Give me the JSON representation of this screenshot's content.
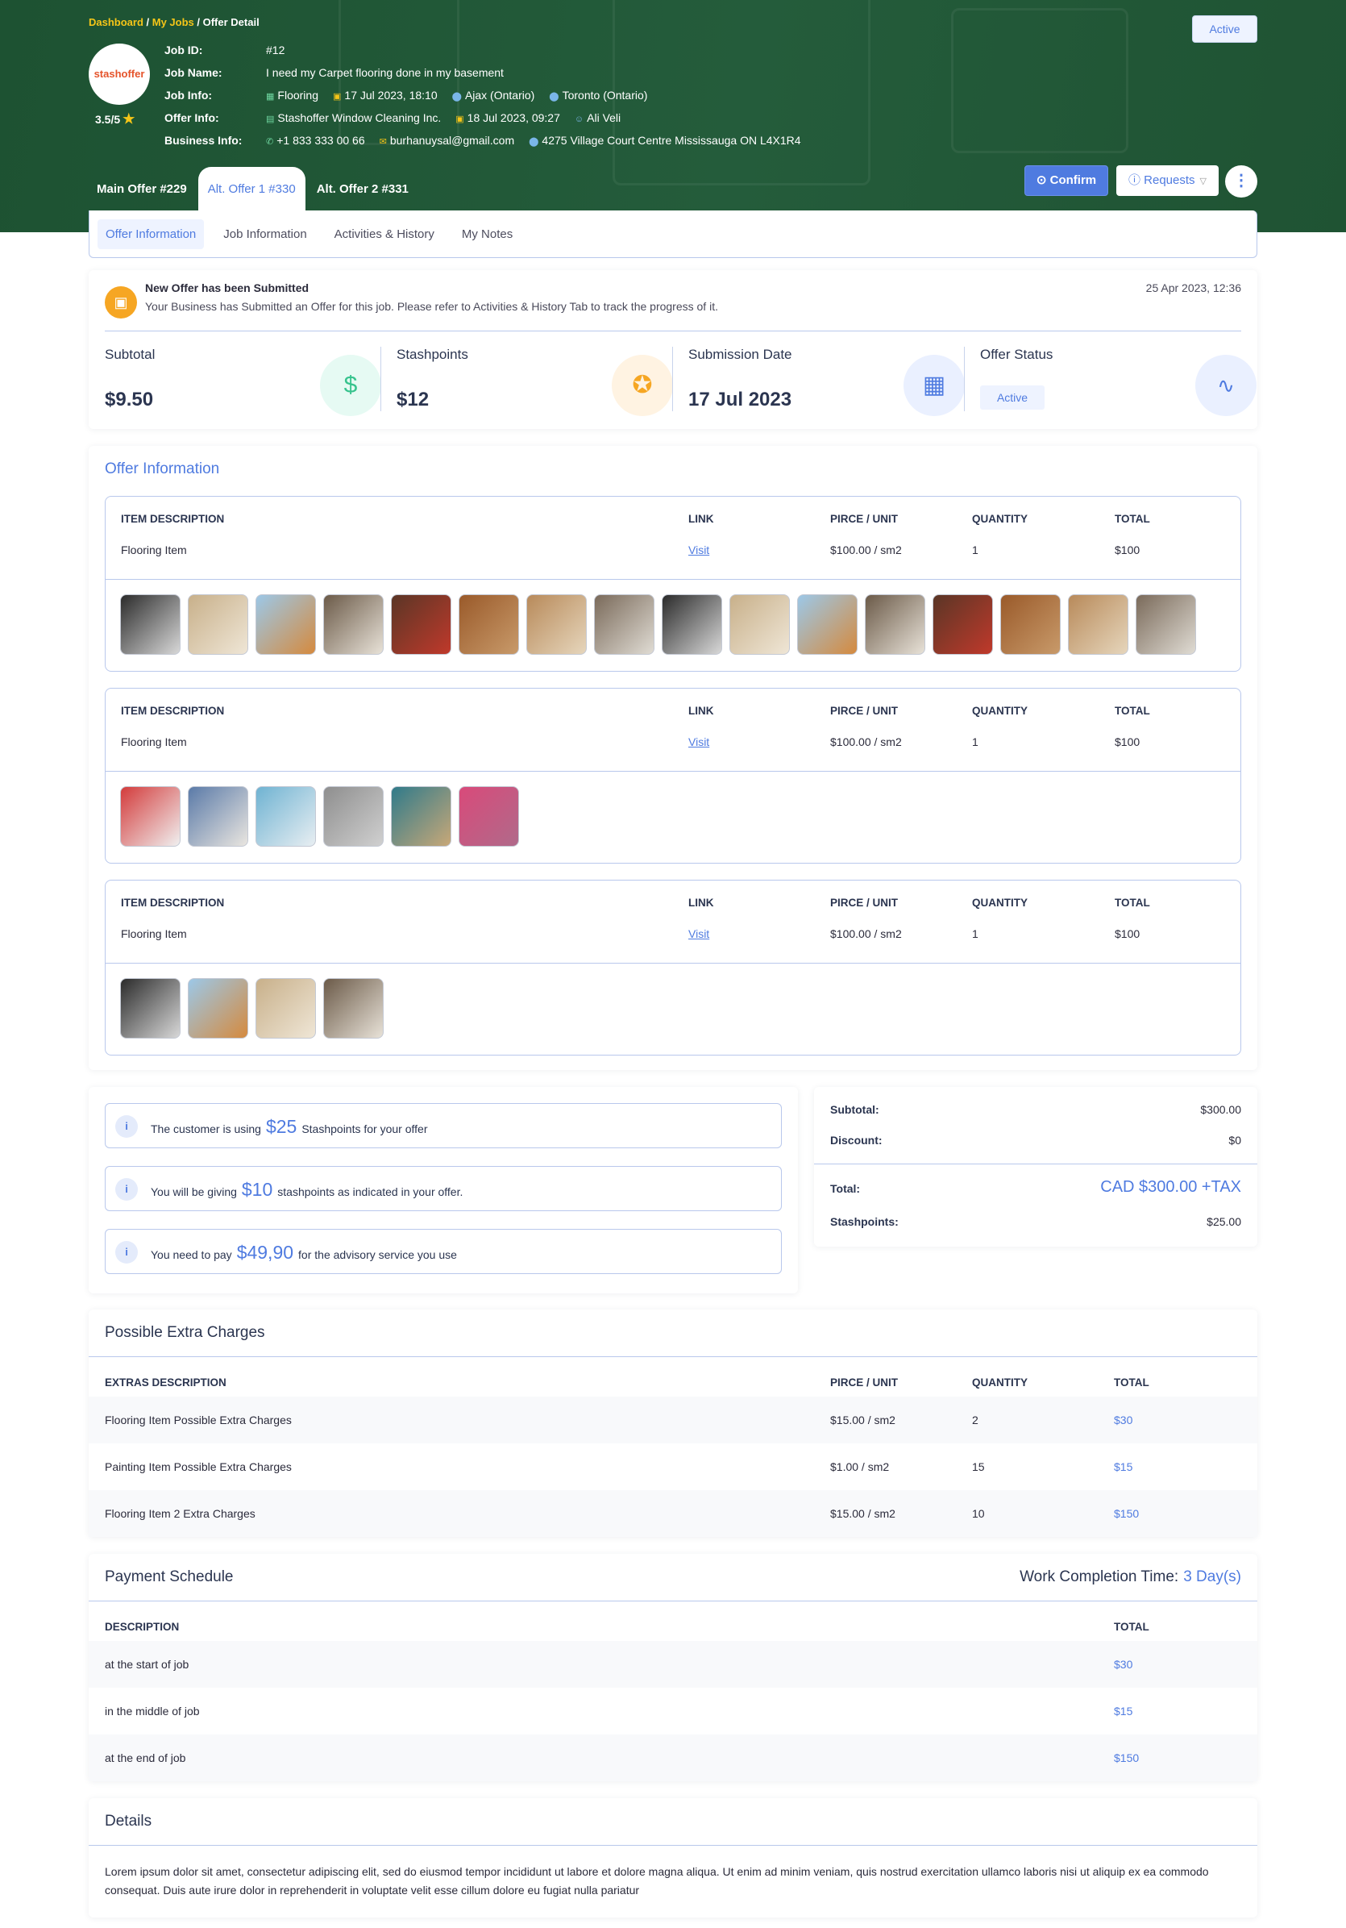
{
  "breadcrumb": {
    "dashboard": "Dashboard",
    "sep1": " / ",
    "myjobs": "My Jobs",
    "sep2": " / ",
    "current": "Offer Detail"
  },
  "header": {
    "status": "Active",
    "logo_text": "stashoffer",
    "rating": "3.5/5",
    "job_id": {
      "label": "Job ID:",
      "value": "#12"
    },
    "job_name": {
      "label": "Job Name:",
      "value": "I need my Carpet flooring done in my basement"
    },
    "job_info": {
      "label": "Job Info:",
      "category": "Flooring",
      "date": "17 Jul 2023, 18:10",
      "from": "Ajax (Ontario)",
      "to": "Toronto (Ontario)"
    },
    "offer_info": {
      "label": "Offer Info:",
      "company": "Stashoffer Window Cleaning Inc.",
      "date": "18 Jul 2023, 09:27",
      "person": "Ali Veli"
    },
    "business_info": {
      "label": "Business Info:",
      "phone": "+1 833 333 00 66",
      "email": "burhanuysal@gmail.com",
      "address": "4275 Village Court Centre Mississauga ON L4X1R4"
    }
  },
  "offer_tabs": [
    "Main Offer #229",
    "Alt. Offer 1 #330",
    "Alt. Offer 2 #331"
  ],
  "actions": {
    "confirm": "Confirm",
    "requests": "Requests"
  },
  "subnav": [
    "Offer Information",
    "Job Information",
    "Activities & History",
    "My Notes"
  ],
  "notice": {
    "title": "New Offer has been Submitted",
    "text": "Your Business has Submitted an Offer for this job. Please refer to Activities & History Tab to track the progress of it.",
    "date": "25 Apr 2023, 12:36"
  },
  "stats": [
    {
      "label": "Subtotal",
      "value": "$9.50"
    },
    {
      "label": "Stashpoints",
      "value": "$12"
    },
    {
      "label": "Submission Date",
      "value": "17 Jul 2023"
    },
    {
      "label": "Offer Status",
      "value": "Active"
    }
  ],
  "offer_information": {
    "title": "Offer Information",
    "headers": {
      "desc": "ITEM DESCRIPTION",
      "link": "LINK",
      "price": "PIRCE / UNIT",
      "qty": "QUANTITY",
      "total": "TOTAL"
    },
    "items": [
      {
        "desc": "Flooring Item",
        "link": "Visit",
        "price": "$100.00 / sm2",
        "qty": "1",
        "total": "$100",
        "thumbs": 16
      },
      {
        "desc": "Flooring Item",
        "link": "Visit",
        "price": "$100.00 / sm2",
        "qty": "1",
        "total": "$100",
        "thumbs": 6
      },
      {
        "desc": "Flooring Item",
        "link": "Visit",
        "price": "$100.00 / sm2",
        "qty": "1",
        "total": "$100",
        "thumbs": 4
      }
    ]
  },
  "points": [
    {
      "pre": "The customer is using",
      "amount": "$25",
      "post": "Stashpoints for your offer"
    },
    {
      "pre": "You will be giving",
      "amount": "$10",
      "post": "stashpoints as indicated in your offer."
    },
    {
      "pre": "You need to pay",
      "amount": "$49,90",
      "post": "for the advisory service you use"
    }
  ],
  "summary": {
    "subtotal": {
      "label": "Subtotal:",
      "value": "$300.00"
    },
    "discount": {
      "label": "Discount:",
      "value": "$0"
    },
    "total": {
      "label": "Total:",
      "value": "CAD $300.00 +TAX"
    },
    "stashpoints": {
      "label": "Stashpoints:",
      "value": "$25.00"
    }
  },
  "extras": {
    "title": "Possible Extra Charges",
    "headers": {
      "desc": "EXTRAS DESCRIPTION",
      "price": "PIRCE / UNIT",
      "qty": "QUANTITY",
      "total": "TOTAL"
    },
    "rows": [
      {
        "desc": "Flooring Item Possible Extra Charges",
        "price": "$15.00 / sm2",
        "qty": "2",
        "total": "$30"
      },
      {
        "desc": "Painting Item Possible Extra Charges",
        "price": "$1.00 / sm2",
        "qty": "15",
        "total": "$15"
      },
      {
        "desc": "Flooring Item 2 Extra Charges",
        "price": "$15.00 / sm2",
        "qty": "10",
        "total": "$150"
      }
    ]
  },
  "payment": {
    "title": "Payment Schedule",
    "wct_label": "Work Completion Time:",
    "wct_value": "3 Day(s)",
    "headers": {
      "desc": "DESCRIPTION",
      "total": "TOTAL"
    },
    "rows": [
      {
        "desc": "at the start of job",
        "total": "$30"
      },
      {
        "desc": "in the middle of job",
        "total": "$15"
      },
      {
        "desc": "at the end of job",
        "total": "$150"
      }
    ]
  },
  "details": {
    "title": "Details",
    "text": "Lorem ipsum dolor sit amet, consectetur adipiscing elit, sed do eiusmod tempor incididunt ut labore et dolore magna aliqua. Ut enim ad minim veniam, quis nostrud exercitation ullamco laboris nisi ut aliquip ex ea commodo consequat. Duis aute irure dolor  in reprehenderit in voluptate velit esse cillum dolore eu fugiat nulla pariatur"
  },
  "colors": {
    "accent": "#4f7be0",
    "hero": "#245c3b",
    "highlight": "#f5c518"
  }
}
